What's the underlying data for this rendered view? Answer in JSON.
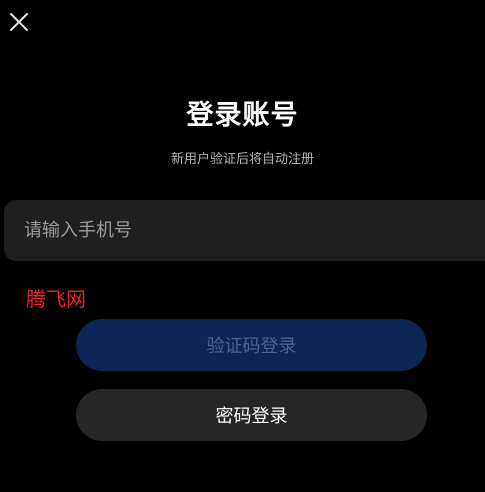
{
  "header": {
    "close_icon": "close-icon"
  },
  "login": {
    "title": "登录账号",
    "subtitle": "新用户验证后将自动注册",
    "phone_placeholder": "请输入手机号",
    "phone_value": "",
    "code_login_label": "验证码登录",
    "password_login_label": "密码登录"
  },
  "watermark": {
    "text": "腾飞网"
  },
  "colors": {
    "background": "#000000",
    "field_background": "#1f1f1f",
    "primary_disabled": "#0c2552",
    "primary_disabled_text": "#4d6489",
    "secondary_button": "#262626",
    "watermark": "#e8212e"
  }
}
